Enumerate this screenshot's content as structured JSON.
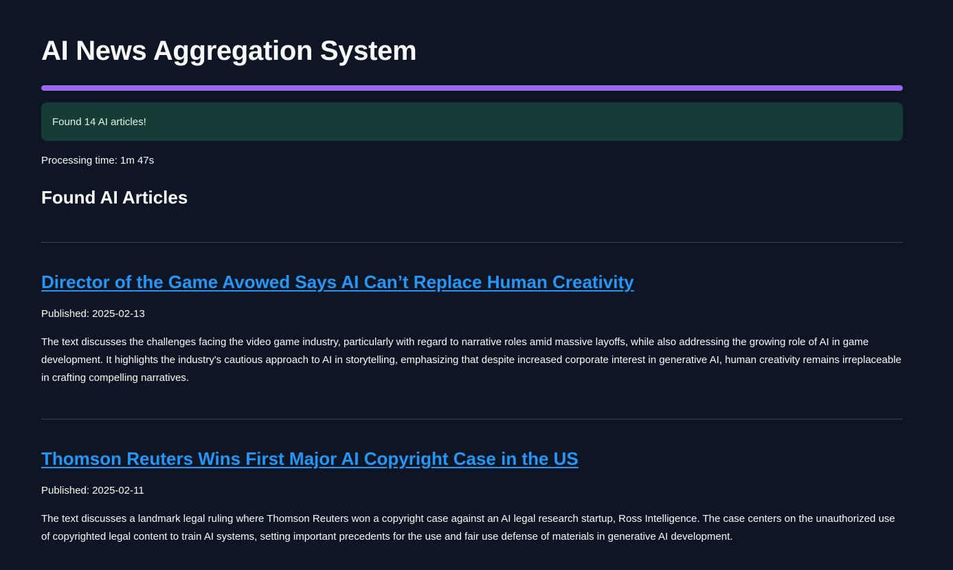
{
  "app": {
    "title": "AI News Aggregation System"
  },
  "progress": {
    "value_percent": 100,
    "color": "#9a6bf0"
  },
  "status": {
    "success_message": "Found 14 AI articles!",
    "processing_time": "Processing time: 1m 47s"
  },
  "section": {
    "title": "Found AI Articles"
  },
  "articles": [
    {
      "title": "Director of the Game Avowed Says AI Can’t Replace Human Creativity",
      "published_label": "Published:",
      "published_date": "2025-02-13",
      "summary": "The text discusses the challenges facing the video game industry, particularly with regard to narrative roles amid massive layoffs, while also addressing the growing role of AI in game development. It highlights the industry's cautious approach to AI in storytelling, emphasizing that despite increased corporate interest in generative AI, human creativity remains irreplaceable in crafting compelling narratives."
    },
    {
      "title": "Thomson Reuters Wins First Major AI Copyright Case in the US",
      "published_label": "Published:",
      "published_date": "2025-02-11",
      "summary": "The text discusses a landmark legal ruling where Thomson Reuters won a copyright case against an AI legal research startup, Ross Intelligence. The case centers on the unauthorized use of copyrighted legal content to train AI systems, setting important precedents for the use and fair use defense of materials in generative AI development."
    }
  ],
  "colors": {
    "background": "#0e1625",
    "link": "#2596f3",
    "success_bg": "#173b36",
    "divider": "#3a4150"
  }
}
